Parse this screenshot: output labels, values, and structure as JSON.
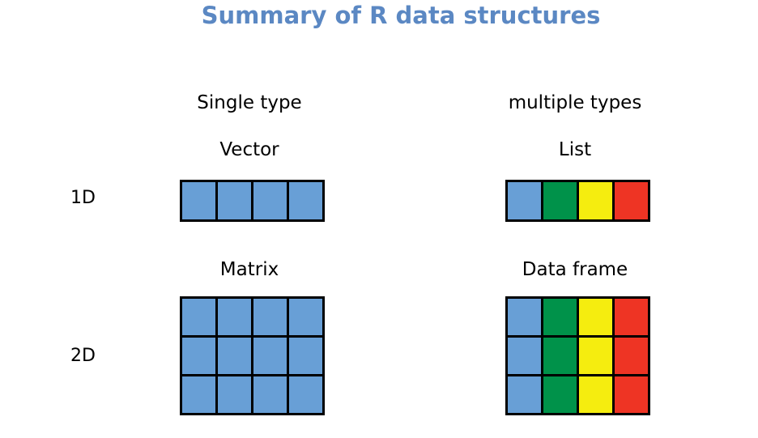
{
  "title": "Summary of R data structures",
  "column_headers": {
    "single": "Single type",
    "multiple": "multiple types"
  },
  "row_labels": {
    "one_d": "1D",
    "two_d": "2D"
  },
  "structures": {
    "vector": "Vector",
    "list": "List",
    "matrix": "Matrix",
    "data_frame": "Data frame"
  },
  "colors": {
    "title": "#5b88c3",
    "blue": "#689fd6",
    "green": "#00924a",
    "yellow": "#f5ed0f",
    "red": "#ee3424",
    "outline": "#000000"
  },
  "grids": {
    "vector": {
      "rows": 1,
      "cols": 4,
      "column_colors": [
        "blue",
        "blue",
        "blue",
        "blue"
      ]
    },
    "list": {
      "rows": 1,
      "cols": 4,
      "column_colors": [
        "blue",
        "green",
        "yellow",
        "red"
      ]
    },
    "matrix": {
      "rows": 3,
      "cols": 4,
      "column_colors": [
        "blue",
        "blue",
        "blue",
        "blue"
      ]
    },
    "data_frame": {
      "rows": 3,
      "cols": 4,
      "column_colors": [
        "blue",
        "green",
        "yellow",
        "red"
      ]
    }
  }
}
